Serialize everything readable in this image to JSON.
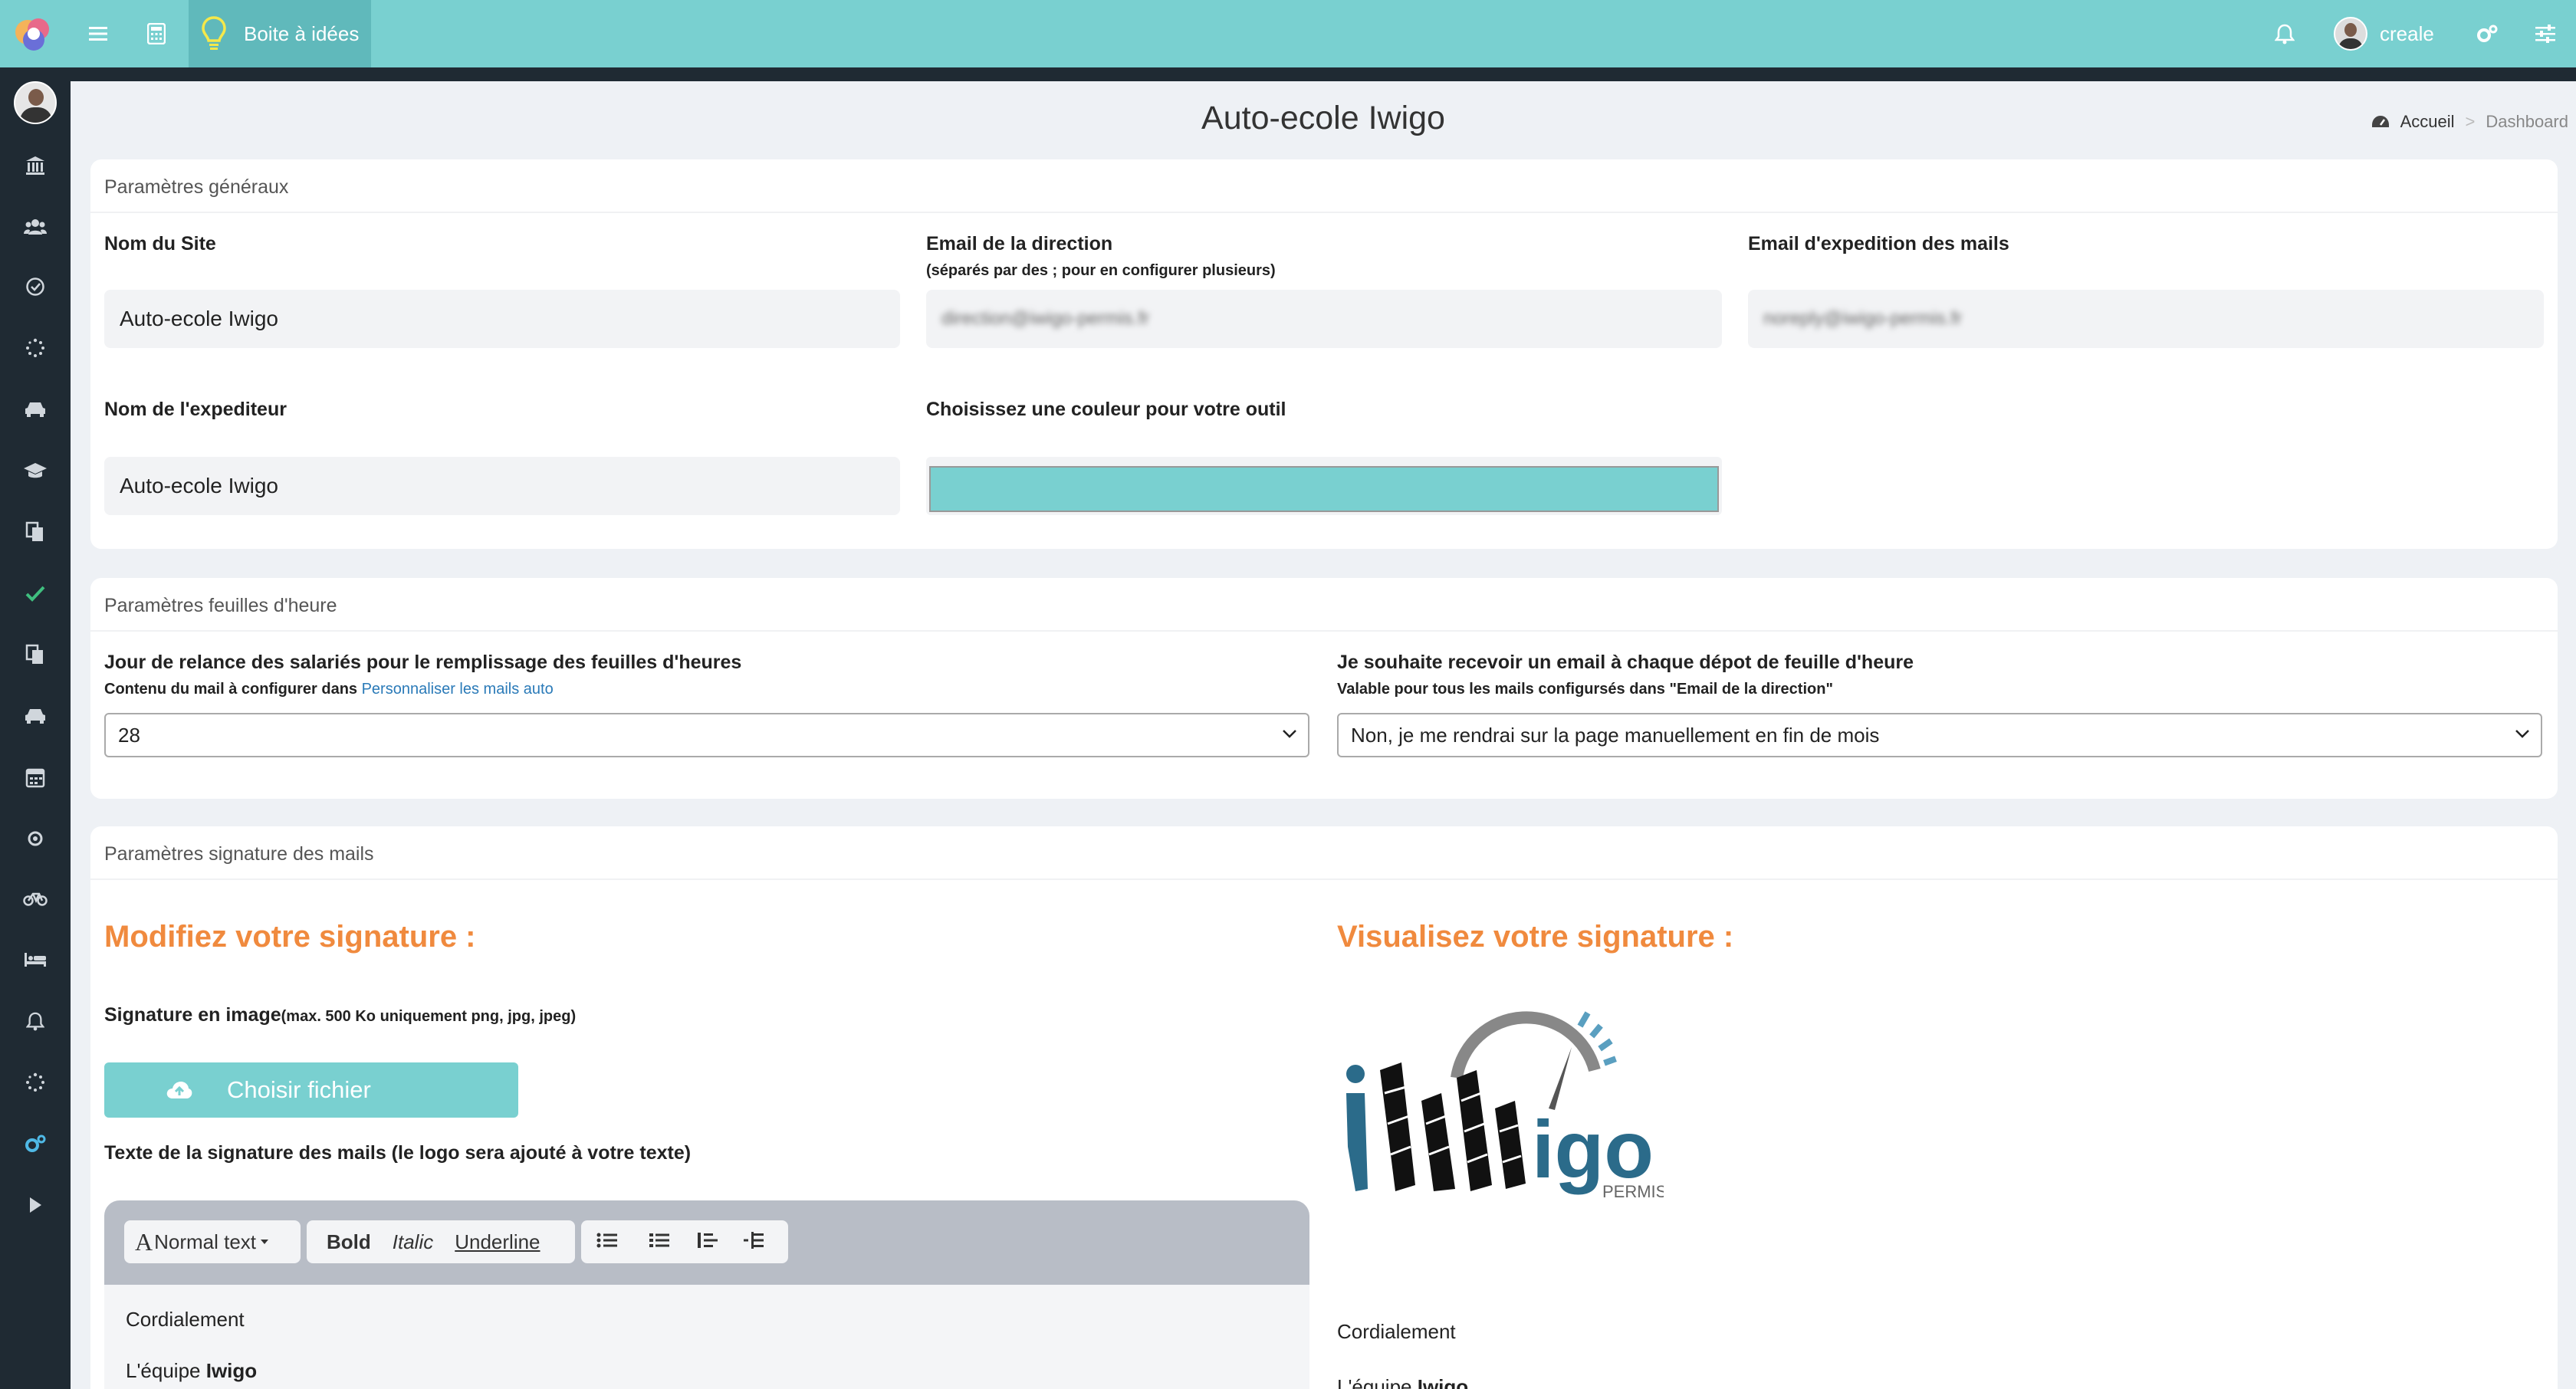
{
  "topbar": {
    "active_label": "Boite à idées",
    "username": "creale",
    "accent_color": "#79d0d0"
  },
  "page": {
    "title": "Auto-ecole Iwigo",
    "breadcrumb": {
      "home": "Accueil",
      "current": "Dashboard"
    }
  },
  "general": {
    "heading": "Paramètres généraux",
    "site_name_label": "Nom du Site",
    "site_name_value": "Auto-ecole Iwigo",
    "direction_email_label": "Email de la direction",
    "direction_email_hint": "(séparés par des ; pour en configurer plusieurs)",
    "direction_email_value": "direction@iwigo-permis.fr",
    "sender_email_label": "Email d'expedition des mails",
    "sender_email_value": "noreply@iwigo-permis.fr",
    "sender_name_label": "Nom de l'expediteur",
    "sender_name_value": "Auto-ecole Iwigo",
    "color_label": "Choisissez une couleur pour votre outil",
    "color_value": "#79d0d0"
  },
  "timesheets": {
    "heading": "Paramètres feuilles d'heure",
    "reminder_label": "Jour de relance des salariés pour le remplissage des feuilles d'heures",
    "reminder_hint": "Contenu du mail à configurer dans",
    "reminder_link": "Personnaliser les mails auto",
    "reminder_value": "28",
    "email_label": "Je souhaite recevoir un email à chaque dépot de feuille d'heure",
    "email_hint": "Valable pour tous les mails configursés dans \"Email de la direction\"",
    "email_value": "Non, je me rendrai sur la page manuellement en fin de mois"
  },
  "signature": {
    "heading": "Paramètres signature des mails",
    "edit_title": "Modifiez votre signature :",
    "image_label": "Signature en image",
    "image_hint": "(max. 500 Ko uniquement png, jpg, jpeg)",
    "file_button": "Choisir fichier",
    "text_label": "Texte de la signature des mails (le logo sera ajouté à votre texte)",
    "toolbar": {
      "format": "Normal text",
      "bold": "Bold",
      "italic": "Italic",
      "underline": "Underline"
    },
    "body_line1": "Cordialement",
    "body_line2_prefix": "L'équipe ",
    "body_line2_bold": "Iwigo",
    "preview_title": "Visualisez votre signature :",
    "preview_line1": "Cordialement",
    "preview_line2_prefix": "L'équipe ",
    "preview_line2_bold": "Iwigo",
    "logo_word": "igo",
    "logo_sub": "PERMIS"
  }
}
